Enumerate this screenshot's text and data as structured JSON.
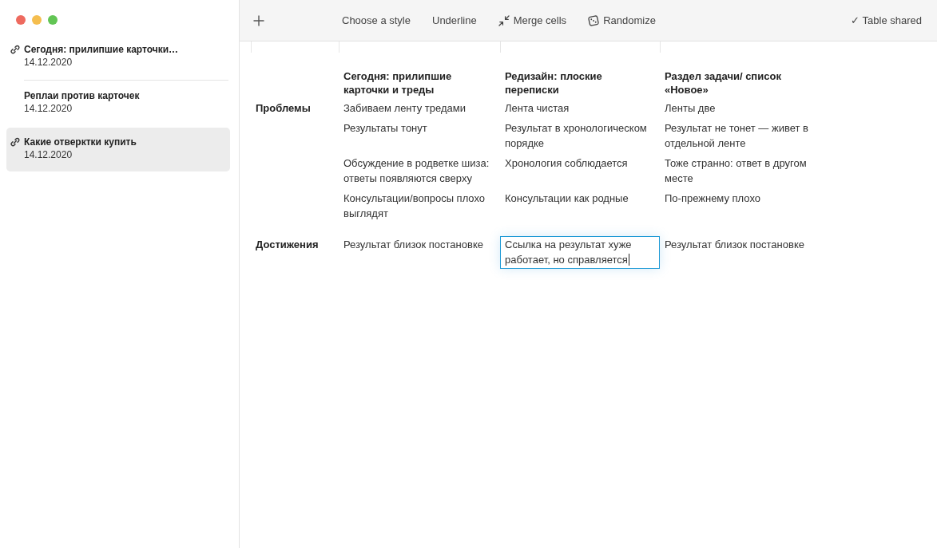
{
  "sidebar": {
    "items": [
      {
        "title": "Сегодня: прилипшие карточки…",
        "date": "14.12.2020",
        "linked": true,
        "selected": false
      },
      {
        "title": "Реплаи против карточек",
        "date": "14.12.2020",
        "linked": false,
        "selected": false
      },
      {
        "title": "Какие отверктки купить",
        "date": "14.12.2020",
        "linked": true,
        "selected": true
      }
    ]
  },
  "toolbar": {
    "buttons": [
      {
        "label": "Choose a style",
        "kind": "text"
      },
      {
        "label": "Underline",
        "kind": "text"
      },
      {
        "label": "Merge cells",
        "kind": "merge"
      },
      {
        "label": "Randomize",
        "kind": "dice"
      }
    ],
    "status": "✓ Table shared"
  },
  "table": {
    "columns": [
      "Сегодня: прилипшие карточки и треды",
      "Редизайн: плоские переписки",
      "Раздел задачи/ список «Новое»"
    ],
    "sections": [
      {
        "label": "Проблемы",
        "rows": [
          {
            "cells": [
              {
                "text": "Забиваем ленту тредами",
                "selected": false
              },
              {
                "text": "Лента чистая",
                "selected": false
              },
              {
                "text": "Ленты две",
                "selected": false
              }
            ]
          },
          {
            "cells": [
              {
                "text": "Результаты тонут",
                "selected": false
              },
              {
                "text": "Результат в хронологическом порядке",
                "selected": false
              },
              {
                "text": "Результат не тонет — живет в отдельной ленте",
                "selected": false
              }
            ]
          },
          {
            "cells": [
              {
                "text": "Обсуждение в родветке шиза: ответы появляются сверху",
                "selected": false
              },
              {
                "text": "Хронология соблюдается",
                "selected": false
              },
              {
                "text": "Тоже странно: ответ в другом месте",
                "selected": false
              }
            ]
          },
          {
            "cells": [
              {
                "text": "Консультации/вопросы плохо выглядят",
                "selected": false
              },
              {
                "text": "Консультации как родные",
                "selected": false
              },
              {
                "text": "По-прежнему плохо",
                "selected": false
              }
            ]
          }
        ]
      },
      {
        "label": "Достижения",
        "rows": [
          {
            "cells": [
              {
                "text": "Результат близок постановке",
                "selected": false
              },
              {
                "text": "Ссылка на результат хуже работает, но справляется",
                "selected": true
              },
              {
                "text": "Результат близок постановке",
                "selected": false
              }
            ]
          }
        ]
      }
    ]
  }
}
